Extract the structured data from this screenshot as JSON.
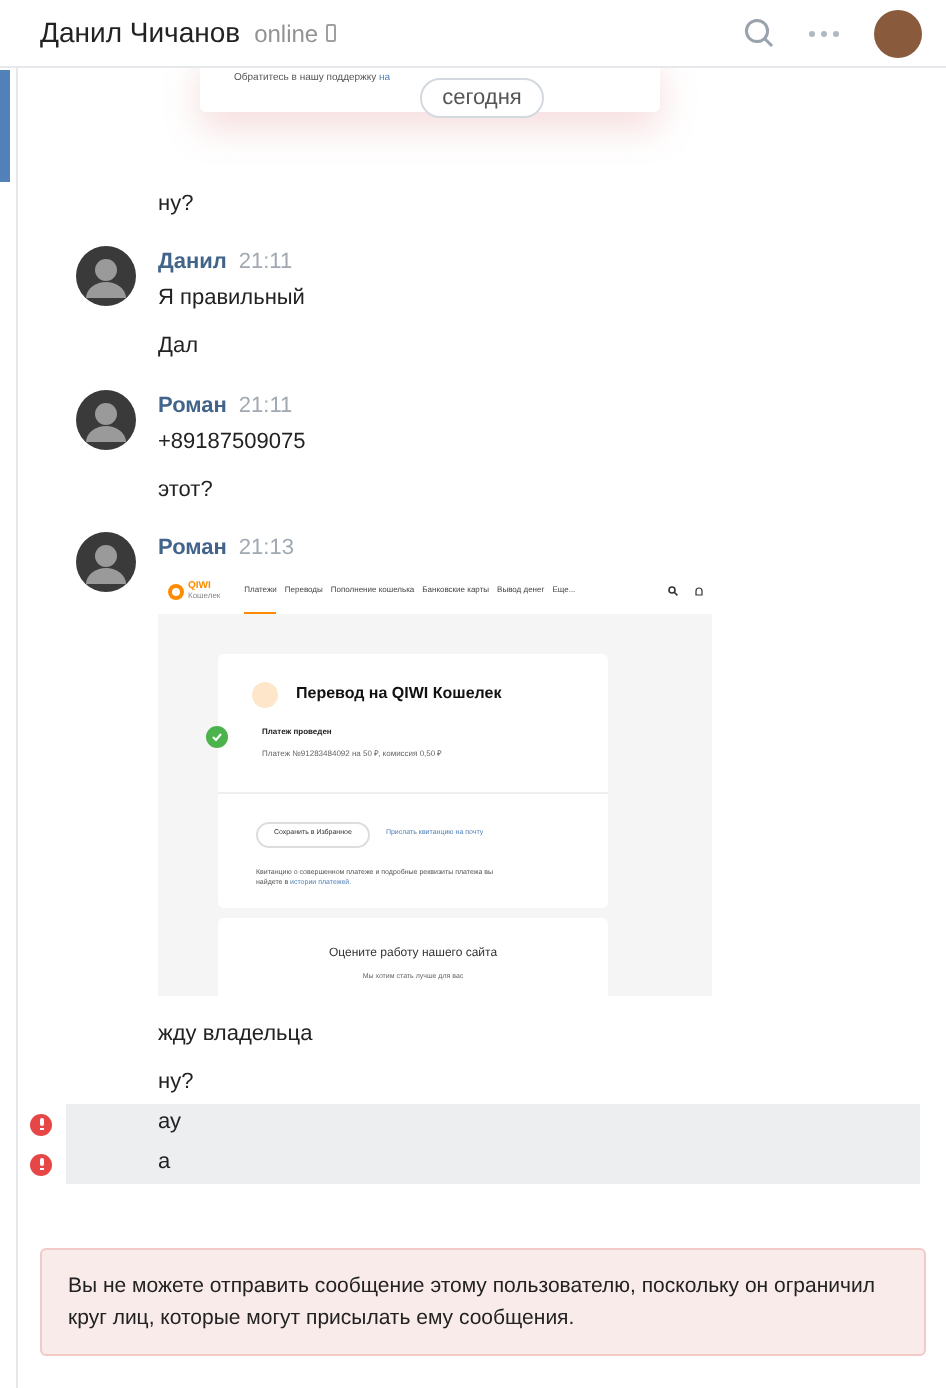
{
  "header": {
    "name": "Данил Чичанов",
    "status": "online"
  },
  "previous_attachment": {
    "text": "Обратитесь в нашу поддержку",
    "link": "на"
  },
  "date_divider": "сегодня",
  "messages": [
    {
      "kind": "text",
      "text": "ну?",
      "failed": false
    },
    {
      "kind": "text",
      "author": "Данил",
      "time": "21:11",
      "text": "Я правильный",
      "failed": false
    },
    {
      "kind": "text",
      "text": "Дал",
      "failed": false
    },
    {
      "kind": "text",
      "author": "Роман",
      "time": "21:11",
      "text": "+89187509075",
      "failed": false
    },
    {
      "kind": "text",
      "text": "этот?",
      "failed": false
    },
    {
      "kind": "image",
      "author": "Роман",
      "time": "21:13",
      "failed": false,
      "screenshot": {
        "logo": "QIWI",
        "logo_sub": "Кошелек",
        "nav": [
          {
            "label": "Платежи",
            "selected": true
          },
          {
            "label": "Переводы",
            "selected": false
          },
          {
            "label": "Пополнение кошелька",
            "selected": false
          },
          {
            "label": "Банковские карты",
            "selected": false
          },
          {
            "label": "Вывод денег",
            "selected": false
          },
          {
            "label": "Еще...",
            "selected": false
          }
        ],
        "title": "Перевод на QIWI Кошелек",
        "status": "Платеж проведен",
        "details": "Платеж №91283484092 на 50 ₽, комиссия 0,50 ₽",
        "save_button": "Сохранить в Избранное",
        "email_link": "Прислать квитанцию на почту",
        "note": "Квитанцию о совершенном платеже и подробные реквизиты платежа вы найдете в",
        "note_link": "истории платежей.",
        "rating_title": "Оцените работу нашего сайта",
        "rating_text": "Мы хотим стать лучше для вас"
      }
    },
    {
      "kind": "text",
      "text": "жду владельца",
      "failed": false
    },
    {
      "kind": "text",
      "text": "ну?",
      "failed": false
    },
    {
      "kind": "text",
      "text": "ау",
      "failed": true
    },
    {
      "kind": "text",
      "text": "а",
      "failed": true
    }
  ],
  "notice": "Вы не можете отправить сообщение этому пользователю, поскольку он ограничил круг лиц, которые могут присылать ему сообщения."
}
